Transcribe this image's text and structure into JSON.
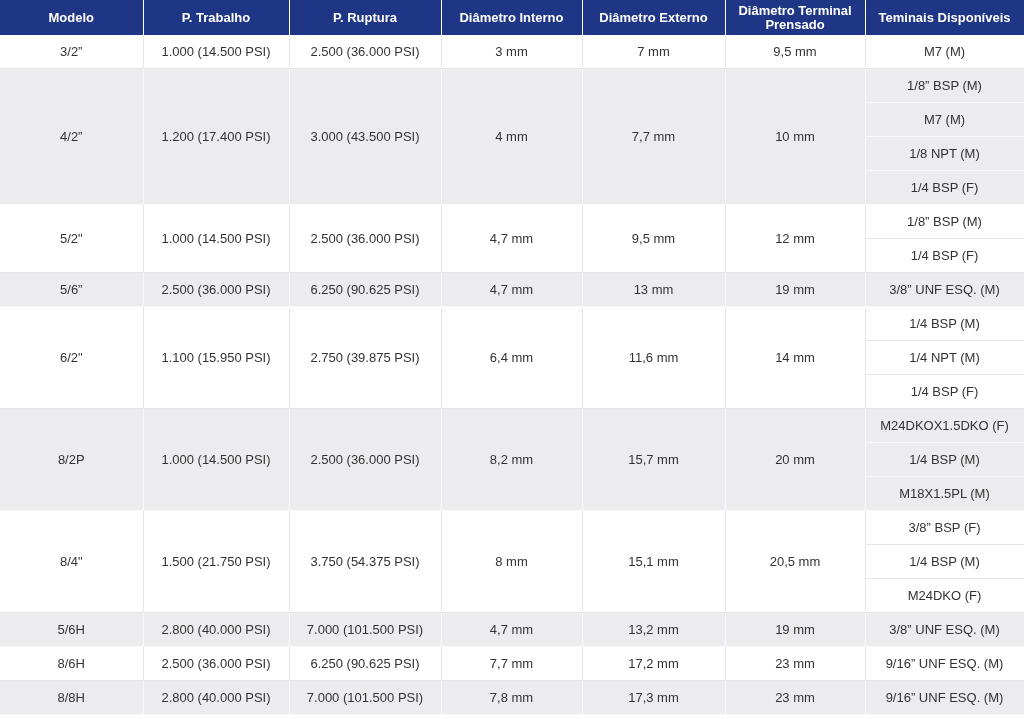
{
  "table": {
    "columns": [
      "Modelo",
      "P. Trabalho",
      "P. Ruptura",
      "Diâmetro Interno",
      "Diâmetro Externo",
      "Diâmetro Terminal Prensado",
      "Teminais Disponíveis"
    ],
    "rows": [
      {
        "cells": [
          "3/2”",
          "1.000 (14.500 PSI)",
          "2.500 (36.000 PSI)",
          "3 mm",
          "7 mm",
          "9,5 mm"
        ],
        "terminals": [
          "M7 (M)"
        ]
      },
      {
        "cells": [
          "4/2”",
          "1.200 (17.400 PSI)",
          "3.000 (43.500 PSI)",
          "4 mm",
          "7,7 mm",
          "10 mm"
        ],
        "terminals": [
          "1/8” BSP (M)",
          "M7 (M)",
          "1/8 NPT (M)",
          "1/4 BSP (F)"
        ]
      },
      {
        "cells": [
          "5/2\"",
          "1.000 (14.500 PSI)",
          "2.500 (36.000 PSI)",
          "4,7 mm",
          "9,5 mm",
          "12 mm"
        ],
        "terminals": [
          "1/8” BSP (M)",
          "1/4 BSP (F)"
        ]
      },
      {
        "cells": [
          "5/6”",
          "2.500 (36.000 PSI)",
          "6.250 (90.625 PSI)",
          "4,7 mm",
          "13 mm",
          "19 mm"
        ],
        "terminals": [
          "3/8” UNF ESQ. (M)"
        ]
      },
      {
        "cells": [
          "6/2\"",
          "1.100 (15.950 PSI)",
          "2.750  (39.875 PSI)",
          "6,4 mm",
          "11,6 mm",
          "14 mm"
        ],
        "terminals": [
          "1/4 BSP (M)",
          "1/4 NPT (M)",
          "1/4 BSP (F)"
        ]
      },
      {
        "cells": [
          "8/2P",
          "1.000 (14.500 PSI)",
          "2.500 (36.000 PSI)",
          "8,2 mm",
          "15,7 mm",
          "20 mm"
        ],
        "terminals": [
          "M24DKOX1.5DKO (F)",
          "1/4 BSP (M)",
          "M18X1.5PL (M)"
        ]
      },
      {
        "cells": [
          "8/4\"",
          "1.500 (21.750 PSI)",
          "3.750 (54.375 PSI)",
          "8 mm",
          "15,1 mm",
          "20,5 mm"
        ],
        "terminals": [
          "3/8” BSP (F)",
          "1/4 BSP (M)",
          "M24DKO (F)"
        ]
      },
      {
        "cells": [
          "5/6H",
          "2.800 (40.000 PSI)",
          "7.000  (101.500 PSI)",
          "4,7 mm",
          "13,2 mm",
          "19 mm"
        ],
        "terminals": [
          "3/8” UNF ESQ. (M)"
        ]
      },
      {
        "cells": [
          "8/6H",
          "2.500 (36.000 PSI)",
          "6.250 (90.625 PSI)",
          "7,7 mm",
          "17,2 mm",
          "23 mm"
        ],
        "terminals": [
          "9/16” UNF ESQ. (M)"
        ]
      },
      {
        "cells": [
          "8/8H",
          "2.800 (40.000 PSI)",
          "7.000 (101.500 PSI)",
          "7,8 mm",
          "17,3 mm",
          "23 mm"
        ],
        "terminals": [
          "9/16” UNF ESQ. (M)"
        ]
      }
    ]
  }
}
